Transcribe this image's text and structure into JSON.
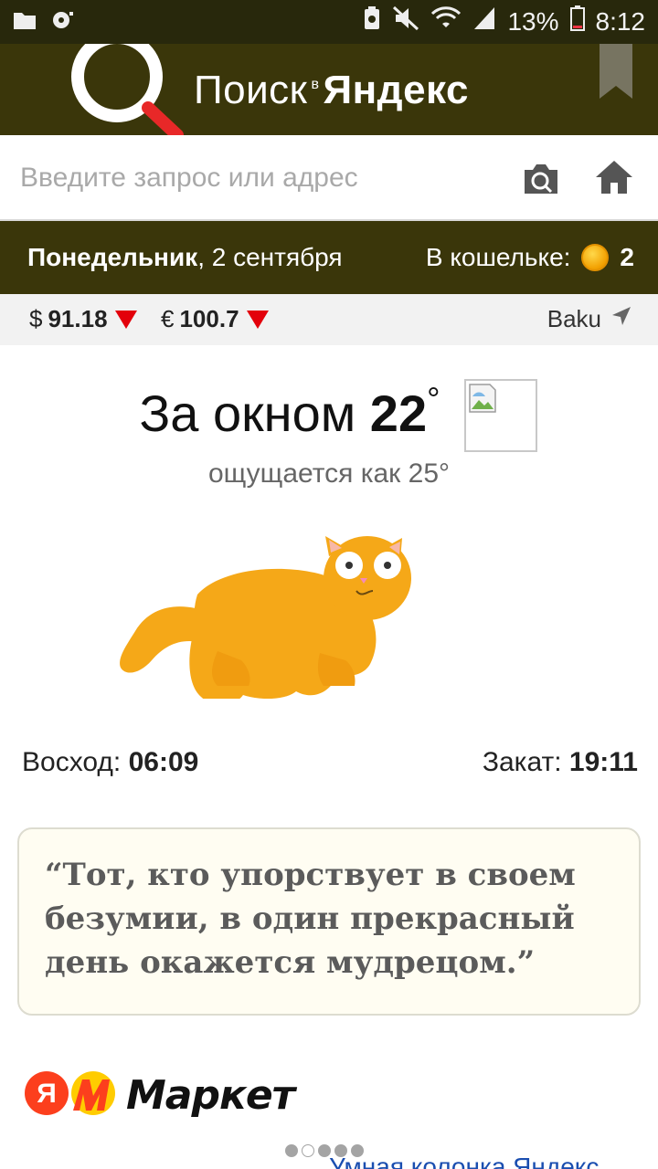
{
  "status_bar": {
    "battery": "13%",
    "time": "8:12",
    "icons": [
      "folder-icon",
      "media-icon",
      "recycle-icon",
      "mute-icon",
      "wifi-icon",
      "signal-icon",
      "battery-icon"
    ]
  },
  "header": {
    "title_main": "Поиск",
    "title_small": "в",
    "title_brand": "Яндекс",
    "icons": [
      "magnifier-logo-icon",
      "bookmark-icon"
    ]
  },
  "search": {
    "placeholder": "Введите запрос или адрес",
    "value": "",
    "icons": [
      "camera-search-icon",
      "home-icon"
    ]
  },
  "date_bar": {
    "weekday": "Понедельник",
    "date": ", 2 сентября",
    "wallet_label": "В кошельке:",
    "wallet_count": "2"
  },
  "rates": {
    "usd_symbol": "$",
    "usd_value": "91.18",
    "eur_symbol": "€",
    "eur_value": "100.7",
    "city": "Baku",
    "colors": {
      "down": "#e3000b"
    }
  },
  "weather": {
    "prefix": "За окном",
    "temp": "22",
    "degree": "°",
    "feels_like": "ощущается как 25°"
  },
  "sun": {
    "sunrise_label": "Восход:",
    "sunrise_time": "06:09",
    "sunset_label": "Закат:",
    "sunset_time": "19:11"
  },
  "quote": {
    "text": "“Тот, кто упорствует в своем безумии, в один прекрасный день окажется мудрецом.”"
  },
  "market": {
    "label": "Маркет",
    "logo_letter": "Я",
    "colors": {
      "brand_red": "#fc3f1d",
      "brand_yellow": "#ffcc00"
    }
  },
  "carousel": {
    "dots": 5,
    "active_index": 1,
    "link_text": "Умная колонка Яндекс"
  },
  "colors": {
    "header_bg": "#3a360a",
    "status_bg": "#28280c",
    "cat": "#f5a818"
  }
}
